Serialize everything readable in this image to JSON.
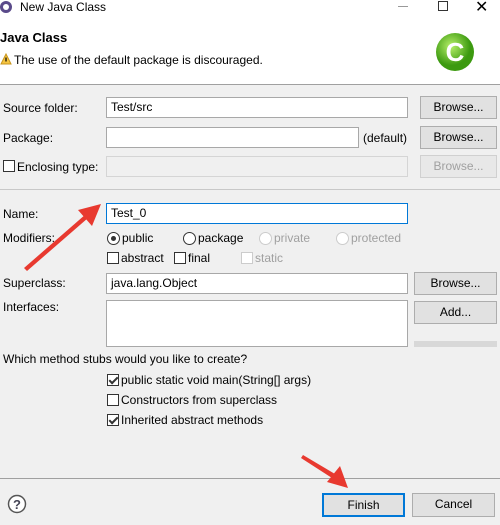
{
  "window": {
    "title": "New Java Class"
  },
  "header": {
    "title": "Java Class",
    "message": "The use of the default package is discouraged.",
    "icon": "java-class-icon"
  },
  "source_folder": {
    "label": "Source folder:",
    "value": "Test/src",
    "browse": "Browse..."
  },
  "package": {
    "label": "Package:",
    "value": "",
    "default_hint": "(default)",
    "browse": "Browse..."
  },
  "enclosing": {
    "label": "Enclosing type:",
    "checked": false,
    "value": "",
    "browse": "Browse..."
  },
  "name": {
    "label": "Name:",
    "value": "Test_0"
  },
  "modifiers": {
    "label": "Modifiers:",
    "radios": [
      {
        "label": "public",
        "selected": true,
        "enabled": true
      },
      {
        "label": "package",
        "selected": false,
        "enabled": true
      },
      {
        "label": "private",
        "selected": false,
        "enabled": false
      },
      {
        "label": "protected",
        "selected": false,
        "enabled": false
      }
    ],
    "checks": [
      {
        "label": "abstract",
        "checked": false,
        "enabled": true
      },
      {
        "label": "final",
        "checked": false,
        "enabled": true
      },
      {
        "label": "static",
        "checked": false,
        "enabled": false
      }
    ]
  },
  "superclass": {
    "label": "Superclass:",
    "value": "java.lang.Object",
    "browse": "Browse..."
  },
  "interfaces": {
    "label": "Interfaces:",
    "add": "Add..."
  },
  "stubs": {
    "question": "Which method stubs would you like to create?",
    "options": [
      {
        "label": "public static void main(String[] args)",
        "checked": true
      },
      {
        "label": "Constructors from superclass",
        "checked": false
      },
      {
        "label": "Inherited abstract methods",
        "checked": true
      }
    ]
  },
  "footer": {
    "finish": "Finish",
    "cancel": "Cancel"
  },
  "colors": {
    "accent": "#0078d7",
    "arrow": "#e8392f"
  }
}
